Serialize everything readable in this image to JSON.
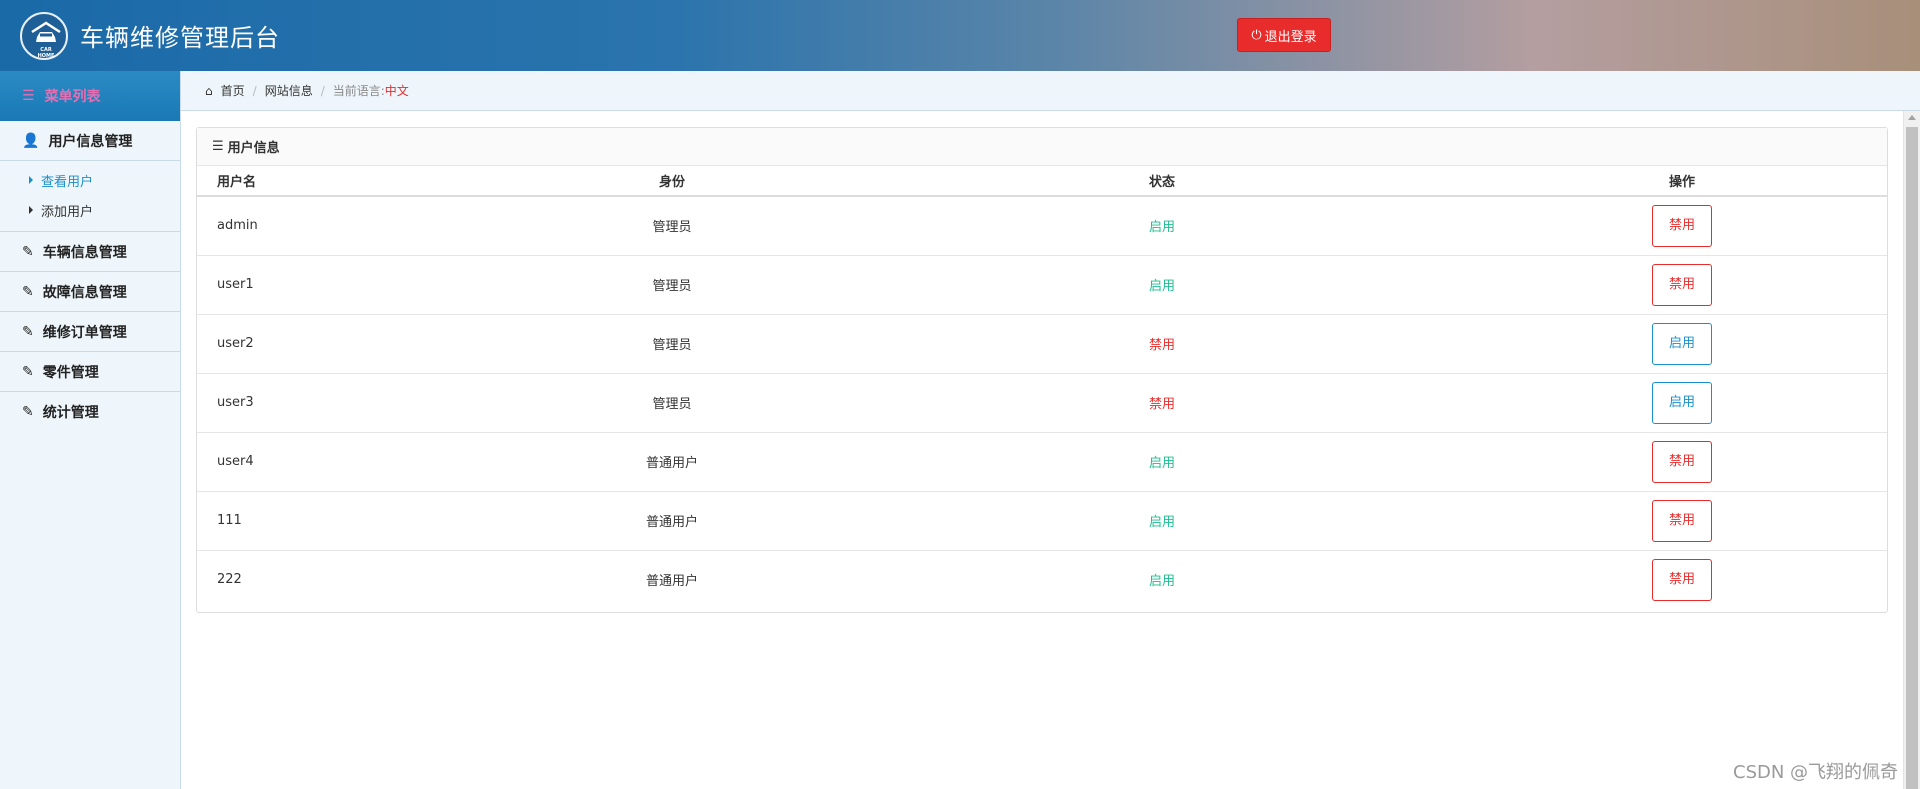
{
  "header": {
    "logo_text": "CAR HOME",
    "title": "车辆维修管理后台",
    "logout_label": "退出登录",
    "logout_color": "#e82c2c"
  },
  "sidebar": {
    "menu_title": "菜单列表",
    "groups": [
      {
        "label": "用户信息管理",
        "icon": "user-icon",
        "items": [
          {
            "label": "查看用户",
            "active": true
          },
          {
            "label": "添加用户",
            "active": false
          }
        ]
      },
      {
        "label": "车辆信息管理",
        "icon": "edit-icon"
      },
      {
        "label": "故障信息管理",
        "icon": "edit-icon"
      },
      {
        "label": "维修订单管理",
        "icon": "edit-icon"
      },
      {
        "label": "零件管理",
        "icon": "edit-icon"
      },
      {
        "label": "统计管理",
        "icon": "edit-icon"
      }
    ]
  },
  "breadcrumb": {
    "home": "首页",
    "section": "网站信息",
    "lang_label": "当前语言:",
    "lang_value": "中文"
  },
  "panel": {
    "title": "用户信息",
    "columns": [
      "用户名",
      "身份",
      "状态",
      "操作"
    ],
    "rows": [
      {
        "username": "admin",
        "role": "管理员",
        "status": "启用",
        "status_on": true,
        "action": "禁用"
      },
      {
        "username": "user1",
        "role": "管理员",
        "status": "启用",
        "status_on": true,
        "action": "禁用"
      },
      {
        "username": "user2",
        "role": "管理员",
        "status": "禁用",
        "status_on": false,
        "action": "启用"
      },
      {
        "username": "user3",
        "role": "管理员",
        "status": "禁用",
        "status_on": false,
        "action": "启用"
      },
      {
        "username": "user4",
        "role": "普通用户",
        "status": "启用",
        "status_on": true,
        "action": "禁用"
      },
      {
        "username": "111",
        "role": "普通用户",
        "status": "启用",
        "status_on": true,
        "action": "禁用"
      },
      {
        "username": "222",
        "role": "普通用户",
        "status": "启用",
        "status_on": true,
        "action": "禁用"
      }
    ]
  },
  "colors": {
    "enabled": "#1fbf8f",
    "disabled": "#e82c2c",
    "enable_button": "#1a90c9"
  },
  "watermark": "CSDN @飞翔的佩奇"
}
